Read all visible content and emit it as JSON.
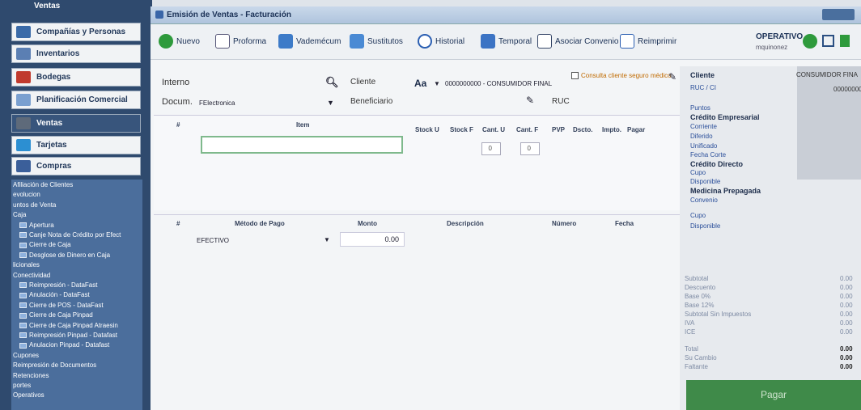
{
  "sidebar": {
    "top_label": "Ventas",
    "modules": [
      "Compañías y Personas",
      "Inventarios",
      "Bodegas",
      "Planificación Comercial",
      "Ventas",
      "Tarjetas",
      "Compras"
    ],
    "tree": [
      {
        "label": "Afiliación de Clientes",
        "indent": 0
      },
      {
        "label": "evolucion",
        "indent": 0
      },
      {
        "label": "untos de Venta",
        "indent": 0
      },
      {
        "label": "Caja",
        "indent": 0
      },
      {
        "label": "Apertura",
        "indent": 1
      },
      {
        "label": "Canje Nota de Crédito por Efect",
        "indent": 1
      },
      {
        "label": "Cierre de Caja",
        "indent": 1
      },
      {
        "label": "Desglose de Dinero en Caja",
        "indent": 1
      },
      {
        "label": "licionales",
        "indent": 0
      },
      {
        "label": "Conectividad",
        "indent": 0
      },
      {
        "label": "Reimpresión - DataFast",
        "indent": 1
      },
      {
        "label": "Anulación - DataFast",
        "indent": 1
      },
      {
        "label": "Cierre de POS - DataFast",
        "indent": 1
      },
      {
        "label": "Cierre de Caja Pinpad",
        "indent": 1
      },
      {
        "label": "Cierre de Caja Pinpad Atraesin",
        "indent": 1
      },
      {
        "label": "Reimpresión Pinpad - Datafast",
        "indent": 1
      },
      {
        "label": "Anulacion Pinpad - Datafast",
        "indent": 1
      },
      {
        "label": "Cupones",
        "indent": 0
      },
      {
        "label": "Reimpresión de Documentos",
        "indent": 0
      },
      {
        "label": "Retenciones",
        "indent": 0
      },
      {
        "label": "portes",
        "indent": 0
      },
      {
        "label": "Operativos",
        "indent": 0
      }
    ]
  },
  "window": {
    "title": "Emisión de Ventas - Facturación"
  },
  "toolbar": {
    "buttons": [
      "Nuevo",
      "Proforma",
      "Vademécum",
      "Sustitutos",
      "Historial",
      "Temporal",
      "Asociar Convenio",
      "Reimprimir"
    ],
    "status": "OPERATIVO",
    "user": "mquinonez"
  },
  "form": {
    "interno_label": "Interno",
    "docum_label": "Docum.",
    "docum_value": "FElectronica",
    "cliente_label": "Cliente",
    "beneficiario_label": "Beneficiario",
    "aa": "Aa",
    "cliente_value": "0000000000 - CONSUMIDOR FINAL",
    "ruc_label": "RUC",
    "seguro_label": "Consulta cliente seguro médico"
  },
  "items": {
    "headers": [
      "#",
      "Item",
      "Stock U",
      "Stock F",
      "Cant. U",
      "Cant. F",
      "PVP",
      "Dscto.",
      "Impto.",
      "Pagar"
    ],
    "cant_u": "0",
    "cant_f": "0"
  },
  "payments": {
    "headers": [
      "#",
      "Método de Pago",
      "Monto",
      "Descripción",
      "Número",
      "Fecha"
    ],
    "method": "EFECTIVO",
    "amount": "0.00"
  },
  "right": {
    "labels": [
      "Cliente",
      "RUC / CI",
      "Puntos",
      "Crédito Empresarial",
      "Corriente",
      "Diferido",
      "Unificado",
      "Fecha Corte",
      "Crédito Directo",
      "Cupo",
      "Disponible",
      "Medicina Prepagada",
      "Convenio",
      "Cupo",
      "Disponible"
    ],
    "cliente_name": "CONSUMIDOR FINA",
    "ruc_value": "000000000",
    "totals_labels": [
      "Subtotal",
      "Descuento",
      "Base 0%",
      "Base 12%",
      "Subtotal Sin Impuestos",
      "IVA",
      "ICE",
      "Total",
      "Su Cambio",
      "Faltante"
    ],
    "totals_values": [
      "0.00",
      "0.00",
      "0.00",
      "0.00",
      "0.00",
      "0.00",
      "0.00",
      "0.00",
      "0.00",
      "0.00"
    ],
    "pagar": "Pagar"
  }
}
